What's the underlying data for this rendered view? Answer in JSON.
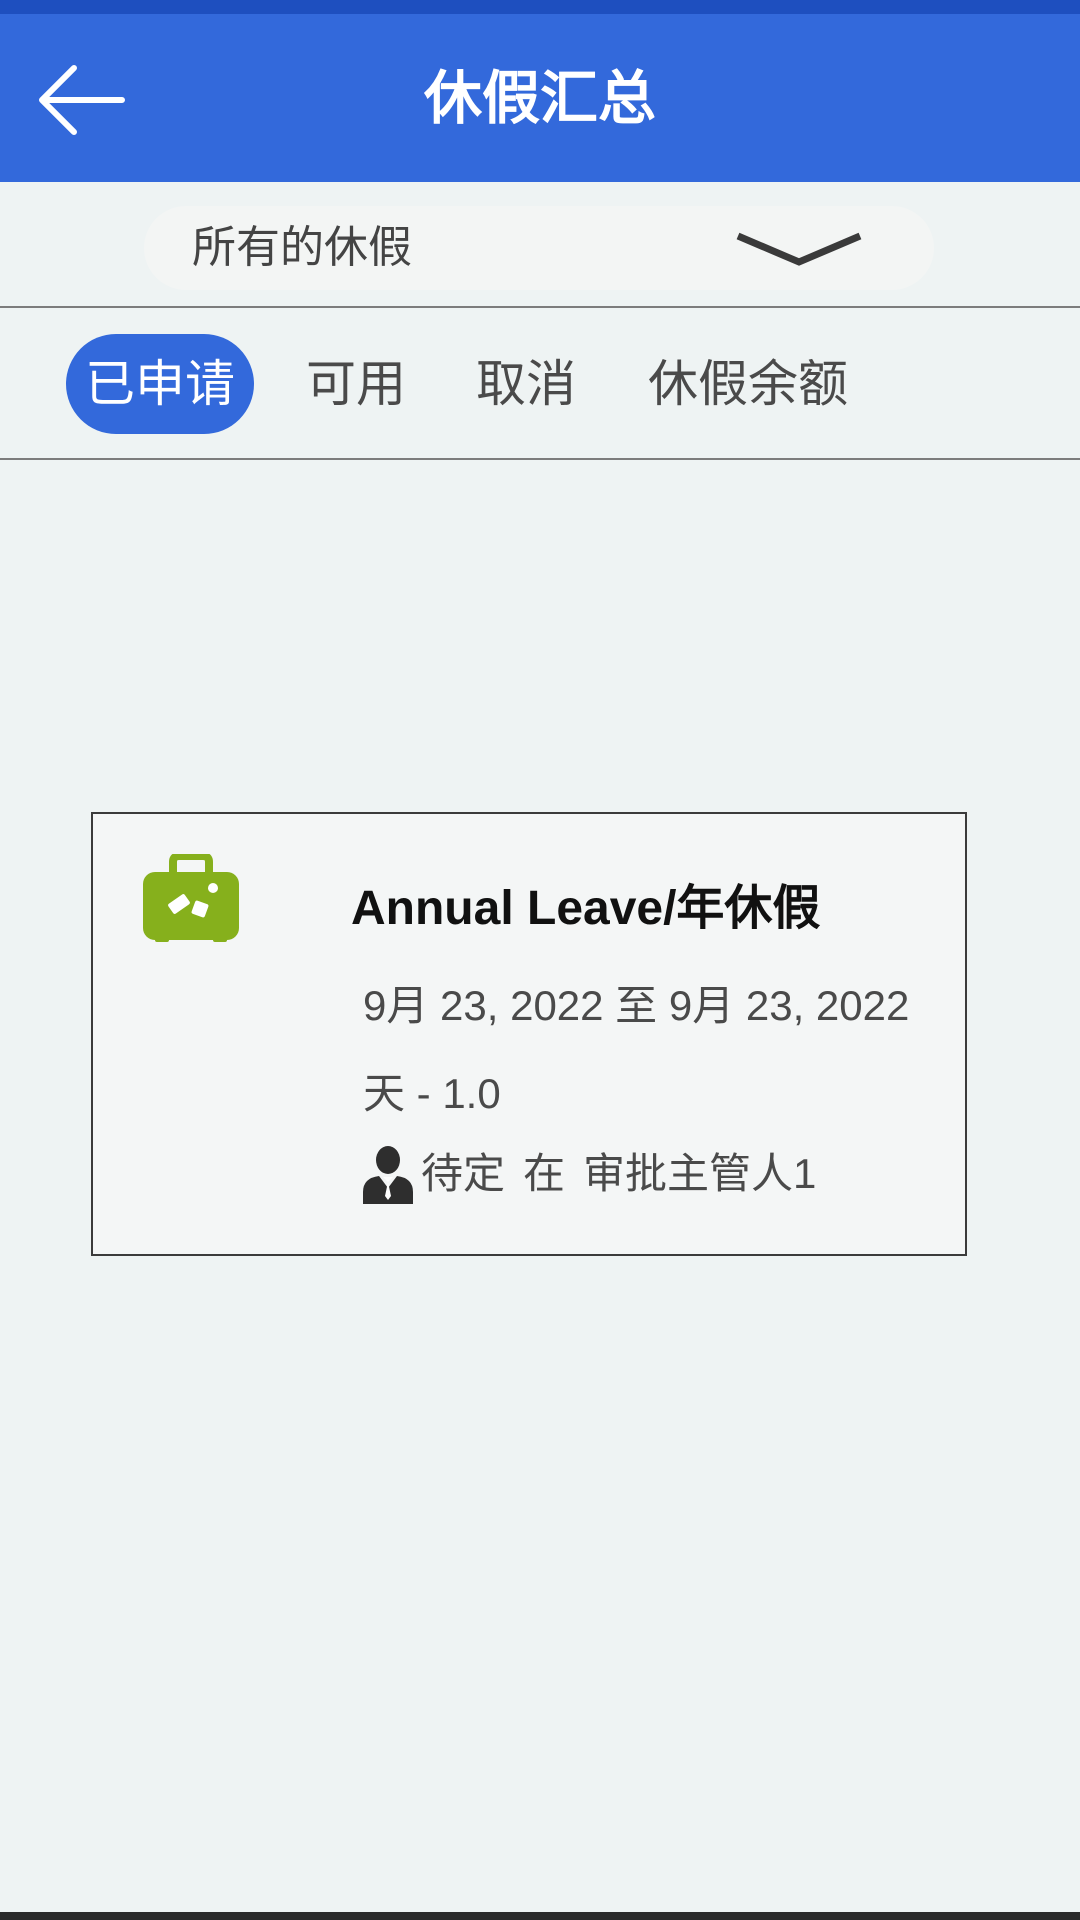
{
  "header": {
    "title": "休假汇总",
    "back_icon": "arrow-left-icon",
    "color": "#3369db"
  },
  "filter": {
    "selected": "所有的休假",
    "icon": "chevron-down-icon"
  },
  "tabs": [
    {
      "label": "已申请",
      "active": true
    },
    {
      "label": "可用",
      "active": false
    },
    {
      "label": "取消",
      "active": false
    },
    {
      "label": "休假余额",
      "active": false
    }
  ],
  "leave_card": {
    "icon": "suitcase-icon",
    "icon_color": "#86b01c",
    "type": "Annual Leave/年休假",
    "dates": "9月 23, 2022 至 9月 23, 2022",
    "days": "天 - 1.0",
    "status": "待定",
    "status_connector": "在",
    "approver": "审批主管人1",
    "approver_icon": "person-icon"
  }
}
